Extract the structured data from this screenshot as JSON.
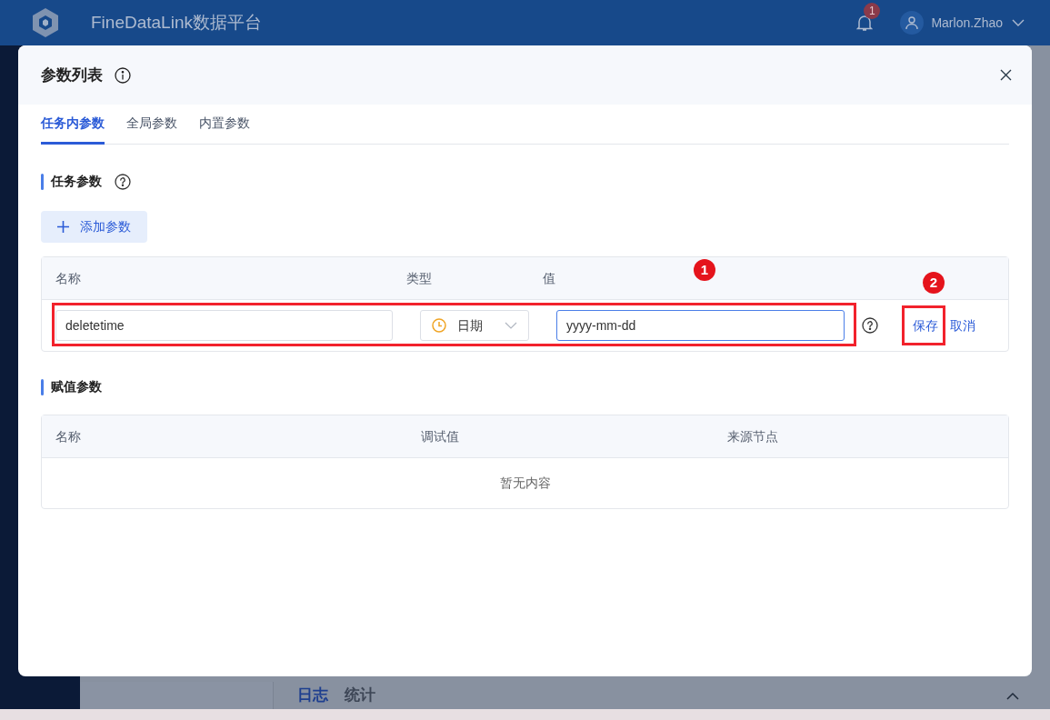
{
  "app_header": {
    "title": "FineDataLink数据平台",
    "notification_count": "1",
    "user": "Marlon.Zhao"
  },
  "background": {
    "bottom_tabs": [
      {
        "label": "日志",
        "selected": true
      },
      {
        "label": "统计",
        "selected": false
      }
    ]
  },
  "dialog": {
    "title": "参数列表",
    "tabs": [
      {
        "label": "任务内参数",
        "selected": true
      },
      {
        "label": "全局参数",
        "selected": false
      },
      {
        "label": "内置参数",
        "selected": false
      }
    ],
    "task_params": {
      "title": "任务参数",
      "add_button": "添加参数",
      "columns": [
        "名称",
        "类型",
        "值"
      ],
      "row": {
        "name": "deletetime",
        "type": "日期",
        "value": "yyyy-mm-dd",
        "actions": [
          "保存",
          "取消"
        ]
      }
    },
    "assign_params": {
      "title": "赋值参数",
      "columns": [
        "名称",
        "调试值",
        "来源节点"
      ],
      "empty_text": "暂无内容"
    },
    "annotations": [
      {
        "label": "1"
      },
      {
        "label": "2"
      }
    ]
  }
}
